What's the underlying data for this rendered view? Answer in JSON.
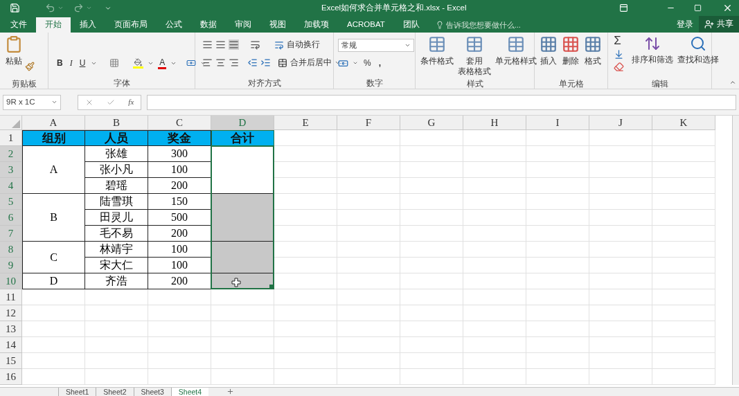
{
  "window": {
    "title": "Excel如何求合并单元格之和.xlsx - Excel"
  },
  "menu_tabs": [
    {
      "label": "文件",
      "selected": false
    },
    {
      "label": "开始",
      "selected": true
    },
    {
      "label": "插入",
      "selected": false
    },
    {
      "label": "页面布局",
      "selected": false
    },
    {
      "label": "公式",
      "selected": false
    },
    {
      "label": "数据",
      "selected": false
    },
    {
      "label": "审阅",
      "selected": false
    },
    {
      "label": "视图",
      "selected": false
    },
    {
      "label": "加载项",
      "selected": false
    },
    {
      "label": "ACROBAT",
      "selected": false
    },
    {
      "label": "团队",
      "selected": false
    }
  ],
  "tell_me": {
    "placeholder": "告诉我您想要做什么..."
  },
  "sign_in": "登录",
  "share": "共享",
  "ribbon": {
    "clipboard": {
      "label": "剪贴板",
      "paste": [
        "粘贴"
      ]
    },
    "font": {
      "label": "字体",
      "bold": "B",
      "italic": "I",
      "underline": "U",
      "font_color": "A"
    },
    "alignment": {
      "label": "对齐方式",
      "wrap_text": "自动换行",
      "merge_center": "合并后居中"
    },
    "number": {
      "label": "数字",
      "format": "常规",
      "percent": "%",
      "comma": ","
    },
    "styles": {
      "label": "样式",
      "buttons": [
        [
          "条件格式"
        ],
        [
          "套用",
          "表格格式"
        ],
        [
          "单元格样式"
        ]
      ]
    },
    "cells": {
      "label": "单元格",
      "buttons": [
        [
          "插入"
        ],
        [
          "删除"
        ],
        [
          "格式"
        ]
      ]
    },
    "editing": {
      "label": "编辑",
      "autosum": "Σ",
      "buttons": [
        [
          "排序和筛选"
        ],
        [
          "查找和选择"
        ]
      ]
    }
  },
  "formula_bar": {
    "name_box": "9R x 1C",
    "function_label": "fx"
  },
  "sheet": {
    "columns": [
      {
        "label": "A",
        "selected": false
      },
      {
        "label": "B",
        "selected": false
      },
      {
        "label": "C",
        "selected": false
      },
      {
        "label": "D",
        "selected": true
      },
      {
        "label": "E",
        "selected": false
      },
      {
        "label": "F",
        "selected": false
      },
      {
        "label": "G",
        "selected": false
      },
      {
        "label": "H",
        "selected": false
      },
      {
        "label": "I",
        "selected": false
      },
      {
        "label": "J",
        "selected": false
      },
      {
        "label": "K",
        "selected": false
      }
    ],
    "rows": [
      {
        "label": "1",
        "selected": false
      },
      {
        "label": "2",
        "selected": true
      },
      {
        "label": "3",
        "selected": true
      },
      {
        "label": "4",
        "selected": true
      },
      {
        "label": "5",
        "selected": true
      },
      {
        "label": "6",
        "selected": true
      },
      {
        "label": "7",
        "selected": true
      },
      {
        "label": "8",
        "selected": true
      },
      {
        "label": "9",
        "selected": true
      },
      {
        "label": "10",
        "selected": true
      },
      {
        "label": "11",
        "selected": false
      },
      {
        "label": "12",
        "selected": false
      },
      {
        "label": "13",
        "selected": false
      },
      {
        "label": "14",
        "selected": false
      },
      {
        "label": "15",
        "selected": false
      },
      {
        "label": "16",
        "selected": false
      }
    ],
    "header": [
      "组别",
      "人员",
      "奖金",
      "合计"
    ],
    "groups": [
      {
        "name": "A",
        "total_active": true,
        "members": [
          {
            "name": "张雄",
            "bonus": "300"
          },
          {
            "name": "张小凡",
            "bonus": "100"
          },
          {
            "name": "碧瑶",
            "bonus": "200"
          }
        ]
      },
      {
        "name": "B",
        "total_active": false,
        "members": [
          {
            "name": "陆雪琪",
            "bonus": "150"
          },
          {
            "name": "田灵儿",
            "bonus": "500"
          },
          {
            "name": "毛不易",
            "bonus": "200"
          }
        ]
      },
      {
        "name": "C",
        "total_active": false,
        "members": [
          {
            "name": "林靖宇",
            "bonus": "100"
          },
          {
            "name": "宋大仁",
            "bonus": "100"
          }
        ]
      },
      {
        "name": "D",
        "total_active": false,
        "members": [
          {
            "name": "齐浩",
            "bonus": "200"
          }
        ]
      }
    ]
  },
  "sheet_tabs": [
    {
      "label": "Sheet1",
      "selected": false
    },
    {
      "label": "Sheet2",
      "selected": false
    },
    {
      "label": "Sheet3",
      "selected": false
    },
    {
      "label": "Sheet4",
      "selected": true
    }
  ]
}
